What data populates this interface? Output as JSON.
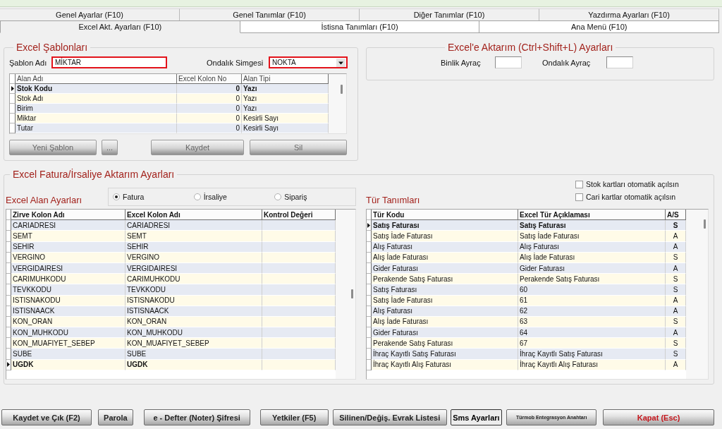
{
  "tabs_row_1": [
    {
      "label": "Genel Ayarlar (F10)",
      "selected": false
    },
    {
      "label": "Genel Tanımlar (F10)",
      "selected": false
    },
    {
      "label": "Diğer Tanımlar (F10)",
      "selected": false
    },
    {
      "label": "Yazdırma Ayarları (F10)",
      "selected": false
    }
  ],
  "tabs_row_2": [
    {
      "label": "Excel Akt. Ayarları (F10)",
      "selected": true
    },
    {
      "label": "İstisna Tanımları (F10)",
      "selected": false
    },
    {
      "label": "Ana Menü (F10)",
      "selected": false
    }
  ],
  "excel_templates": {
    "title": "Excel Şablonları",
    "template_name": {
      "label": "Şablon Adı",
      "value": "MİKTAR",
      "highlighted": true
    },
    "decimal_symbol": {
      "label": "Ondalık Simgesi",
      "value": "NOKTA",
      "highlighted": true
    },
    "table": {
      "columns": [
        "Alan Adı",
        "Excel Kolon No",
        "Alan Tipi"
      ],
      "rows": [
        {
          "cells": [
            "Stok Kodu",
            "0",
            "Yazı"
          ],
          "selected": true
        },
        {
          "cells": [
            "Stok Adı",
            "0",
            "Yazı"
          ],
          "selected": false
        },
        {
          "cells": [
            "Birim",
            "0",
            "Yazı"
          ],
          "selected": false
        },
        {
          "cells": [
            "Miktar",
            "0",
            "Kesirli Sayı"
          ],
          "selected": false
        },
        {
          "cells": [
            "Tutar",
            "0",
            "Kesirli Sayı"
          ],
          "selected": false
        }
      ]
    },
    "buttons": [
      "Yeni Şablon",
      "...",
      "Kaydet",
      "Sil"
    ]
  },
  "excel_export": {
    "title": "Excel'e Aktarım (Ctrl+Shift+L) Ayarları",
    "fields": [
      {
        "label": "Binlik Ayraç"
      },
      {
        "label": "Ondalık Ayraç"
      }
    ]
  },
  "invoice_import": {
    "title": "Excel Fatura/İrsaliye Aktarım Ayarları",
    "field_settings": {
      "title": "Excel Alan Ayarları",
      "document_types": [
        {
          "label": "Fatura",
          "selected": true
        },
        {
          "label": "İrsaliye",
          "selected": false
        },
        {
          "label": "Sipariş",
          "selected": false
        }
      ],
      "table": {
        "columns": [
          "Zirve Kolon Adı",
          "Excel Kolon Adı",
          "Kontrol Değeri"
        ],
        "rows": [
          {
            "cells": [
              "CARIADRESI",
              "CARIADRESI"
            ],
            "selected": false
          },
          {
            "cells": [
              "SEMT",
              "SEMT"
            ],
            "selected": false
          },
          {
            "cells": [
              "SEHIR",
              "SEHIR"
            ],
            "selected": false
          },
          {
            "cells": [
              "VERGINO",
              "VERGINO"
            ],
            "selected": false
          },
          {
            "cells": [
              "VERGIDAIRESI",
              "VERGIDAIRESI"
            ],
            "selected": false
          },
          {
            "cells": [
              "CARIMUHKODU",
              "CARIMUHKODU"
            ],
            "selected": false
          },
          {
            "cells": [
              "TEVKKODU",
              "TEVKKODU"
            ],
            "selected": false
          },
          {
            "cells": [
              "ISTISNAKODU",
              "ISTISNAKODU"
            ],
            "selected": false
          },
          {
            "cells": [
              "ISTISNAACK",
              "ISTISNAACK"
            ],
            "selected": false
          },
          {
            "cells": [
              "KON_ORAN",
              "KON_ORAN"
            ],
            "selected": false
          },
          {
            "cells": [
              "KON_MUHKODU",
              "KON_MUHKODU"
            ],
            "selected": false
          },
          {
            "cells": [
              "KON_MUAFIYET_SEBEP",
              "KON_MUAFIYET_SEBEP"
            ],
            "selected": false
          },
          {
            "cells": [
              "SUBE",
              "SUBE"
            ],
            "selected": false
          },
          {
            "cells": [
              "UGDK",
              "UGDK"
            ],
            "selected": true
          }
        ]
      }
    },
    "options": [
      {
        "label": "Stok kartları otomatik açılsın",
        "checked": false
      },
      {
        "label": "Cari kartlar otomatik açılsın",
        "checked": false
      }
    ],
    "type_definitions": {
      "title": "Tür Tanımları",
      "table": {
        "columns": [
          "Tür Kodu",
          "Excel Tür Açıklaması",
          "A/S"
        ],
        "rows": [
          {
            "cells": [
              "Satış Faturası",
              "Satış Faturası",
              "S"
            ],
            "selected": true
          },
          {
            "cells": [
              "Satış İade Faturası",
              "Satış İade Faturası",
              "A"
            ],
            "selected": false
          },
          {
            "cells": [
              "Alış Faturası",
              "Alış Faturası",
              "A"
            ],
            "selected": false
          },
          {
            "cells": [
              "Alış İade Faturası",
              "Alış İade Faturası",
              "S"
            ],
            "selected": false
          },
          {
            "cells": [
              "Gider Faturası",
              "Gider Faturası",
              "A"
            ],
            "selected": false
          },
          {
            "cells": [
              "Perakende Satış Faturası",
              "Perakende Satış Faturası",
              "S"
            ],
            "selected": false
          },
          {
            "cells": [
              "Satış Faturası",
              "60",
              "S"
            ],
            "selected": false
          },
          {
            "cells": [
              "Satış İade Faturası",
              "61",
              "A"
            ],
            "selected": false
          },
          {
            "cells": [
              "Alış Faturası",
              "62",
              "A"
            ],
            "selected": false
          },
          {
            "cells": [
              "Alış İade Faturası",
              "63",
              "S"
            ],
            "selected": false
          },
          {
            "cells": [
              "Gider Faturası",
              "64",
              "A"
            ],
            "selected": false
          },
          {
            "cells": [
              "Perakende Satış Faturası",
              "67",
              "S"
            ],
            "selected": false
          },
          {
            "cells": [
              "İhraç Kayıtlı Satış Faturası",
              "İhraç Kayıtlı Satış Faturası",
              "S"
            ],
            "selected": false
          },
          {
            "cells": [
              "İhraç Kayıtlı Alış Faturası",
              "İhraç Kayıtlı Alış Faturası",
              "A"
            ],
            "selected": false
          }
        ]
      }
    }
  },
  "footer_buttons": [
    {
      "label": "Kaydet ve Çık (F2)",
      "kind": "normal"
    },
    {
      "label": "Parola",
      "kind": "normal"
    },
    {
      "label": "e - Defter (Noter) Şifresi",
      "kind": "normal"
    },
    {
      "label": "Yetkiler (F5)",
      "kind": "normal"
    },
    {
      "label": "Silinen/Değiş. Evrak Listesi",
      "kind": "normal"
    },
    {
      "label": "Sms Ayarları",
      "kind": "flat"
    },
    {
      "label": "Türmob Entegrasyon Anahtarı",
      "kind": "small"
    },
    {
      "label": "Kapat (Esc)",
      "kind": "danger"
    }
  ]
}
